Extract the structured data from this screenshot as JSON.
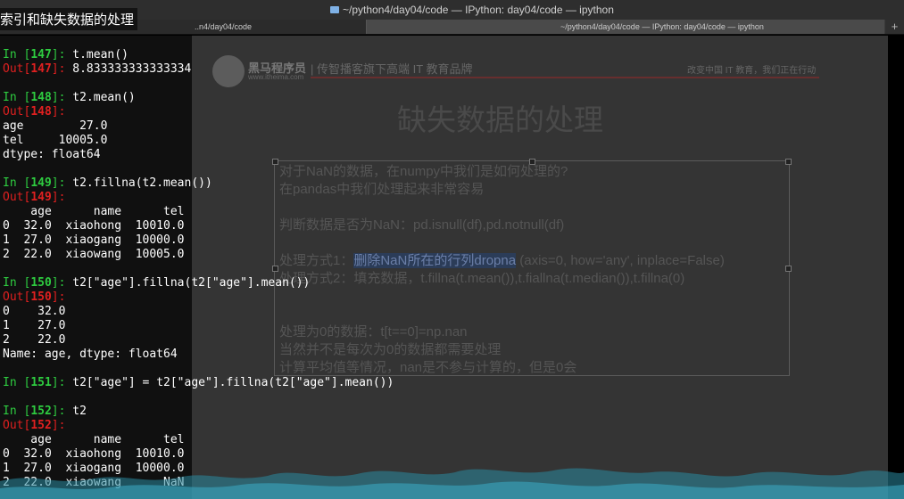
{
  "menubar": {
    "window_title": "~/python4/day04/code — IPython: day04/code — ipython",
    "overlay_title": "索引和缺失数据的处理"
  },
  "tabs": [
    {
      "label": "..n4/day04/code"
    },
    {
      "label": "~/python4/day04/code — IPython: day04/code — ipython"
    }
  ],
  "tab_add": "+",
  "slide": {
    "brand": "黑马程序员",
    "site": "www.itheima.com",
    "slogan": "| 传智播客旗下高端 IT 教育品牌",
    "right_text": "改变中国 IT 教育，我们正在行动",
    "title": "缺失数据的处理",
    "lines": [
      "对于NaN的数据，在numpy中我们是如何处理的?",
      "在pandas中我们处理起来非常容易",
      "",
      "判断数据是否为NaN：pd.isnull(df),pd.notnull(df)",
      "",
      "处理方式1：",
      "删除NaN所在的行列dropna",
      " (axis=0, how='any', inplace=False)",
      "处理方式2：填充数据，t.fillna(t.mean()),t.fiallna(t.median()),t.fillna(0)",
      "",
      "",
      "处理为0的数据：t[t==0]=np.nan",
      "当然并不是每次为0的数据都需要处理",
      "计算平均值等情况，nan是不参与计算的，但是0会"
    ]
  },
  "terminal": {
    "lines": [
      {
        "kind": "in",
        "prompt": "In [",
        "num": "147",
        "close": "]: ",
        "code": "t.mean()"
      },
      {
        "kind": "out",
        "prompt": "Out[",
        "num": "147",
        "close": "]: ",
        "code": "8.833333333333334"
      },
      {
        "kind": "blank"
      },
      {
        "kind": "in",
        "prompt": "In [",
        "num": "148",
        "close": "]: ",
        "code": "t2.mean()"
      },
      {
        "kind": "out",
        "prompt": "Out[",
        "num": "148",
        "close": "]:",
        "code": ""
      },
      {
        "kind": "text",
        "code": "age        27.0"
      },
      {
        "kind": "text",
        "code": "tel     10005.0"
      },
      {
        "kind": "text",
        "code": "dtype: float64"
      },
      {
        "kind": "blank"
      },
      {
        "kind": "in",
        "prompt": "In [",
        "num": "149",
        "close": "]: ",
        "code": "t2.fillna(t2.mean())"
      },
      {
        "kind": "out",
        "prompt": "Out[",
        "num": "149",
        "close": "]:",
        "code": ""
      },
      {
        "kind": "text",
        "code": "    age      name      tel"
      },
      {
        "kind": "text",
        "code": "0  32.0  xiaohong  10010.0"
      },
      {
        "kind": "text",
        "code": "1  27.0  xiaogang  10000.0"
      },
      {
        "kind": "text",
        "code": "2  22.0  xiaowang  10005.0"
      },
      {
        "kind": "blank"
      },
      {
        "kind": "in",
        "prompt": "In [",
        "num": "150",
        "close": "]: ",
        "code": "t2[\"age\"].fillna(t2[\"age\"].mean())"
      },
      {
        "kind": "out",
        "prompt": "Out[",
        "num": "150",
        "close": "]:",
        "code": ""
      },
      {
        "kind": "text",
        "code": "0    32.0"
      },
      {
        "kind": "text",
        "code": "1    27.0"
      },
      {
        "kind": "text",
        "code": "2    22.0"
      },
      {
        "kind": "text",
        "code": "Name: age, dtype: float64"
      },
      {
        "kind": "blank"
      },
      {
        "kind": "in",
        "prompt": "In [",
        "num": "151",
        "close": "]: ",
        "code": "t2[\"age\"] = t2[\"age\"].fillna(t2[\"age\"].mean())"
      },
      {
        "kind": "blank"
      },
      {
        "kind": "in",
        "prompt": "In [",
        "num": "152",
        "close": "]: ",
        "code": "t2"
      },
      {
        "kind": "out",
        "prompt": "Out[",
        "num": "152",
        "close": "]:",
        "code": ""
      },
      {
        "kind": "text",
        "code": "    age      name      tel"
      },
      {
        "kind": "text",
        "code": "0  32.0  xiaohong  10010.0"
      },
      {
        "kind": "text",
        "code": "1  27.0  xiaogang  10000.0"
      },
      {
        "kind": "text",
        "code": "2  22.0  xiaowang      NaN"
      }
    ]
  },
  "colors": {
    "in_prompt": "#2ecc40",
    "out_prompt": "#e02020",
    "selection": "#1f4fd1",
    "string": "#ff3b3b"
  }
}
